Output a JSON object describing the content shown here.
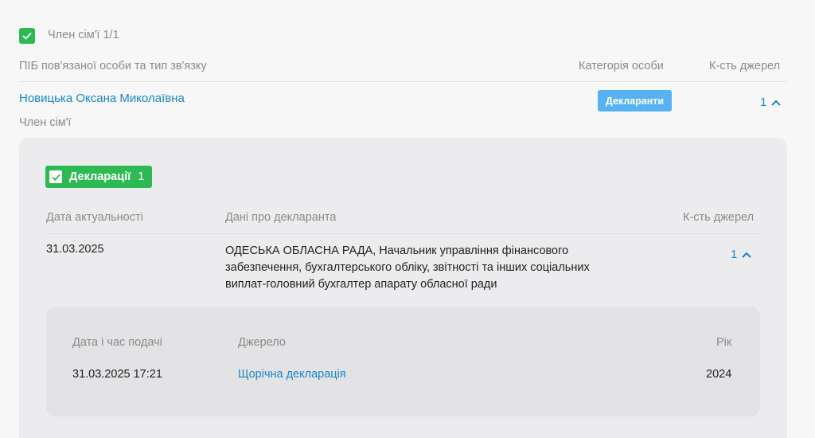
{
  "family": {
    "header_label": "Член сім'ї 1/1",
    "columns": {
      "name": "ПІБ пов'язаної особи та тип зв'язку",
      "category": "Категорія особи",
      "sources": "К-сть джерел"
    },
    "person": {
      "name": "Новицька Оксана Миколаївна",
      "relation": "Член сім'ї",
      "category_badge": "Декларанти",
      "sources_count": "1"
    }
  },
  "declarations": {
    "tag_label": "Декларації",
    "tag_count": "1",
    "columns": {
      "date": "Дата актуальності",
      "info": "Дані про декларанта",
      "sources": "К-сть джерел"
    },
    "row": {
      "date": "31.03.2025",
      "info_line1": "ОДЕСЬКА ОБЛАСНА РАДА, Начальник управління фінансового",
      "info_line2": "забезпечення, бухгалтерського обліку, звітності та інших соціальних",
      "info_line3": "виплат-головний бухгалтер апарату обласної ради",
      "sources_count": "1"
    },
    "sources_table": {
      "columns": {
        "datetime": "Дата і час подачі",
        "source": "Джерело",
        "year": "Рік"
      },
      "row": {
        "datetime": "31.03.2025 17:21",
        "source": "Щорічна декларація",
        "year": "2024"
      }
    }
  },
  "colors": {
    "accent_green": "#2dba54",
    "link_blue": "#1787c9",
    "badge_blue": "#56b2f2"
  },
  "icons": [
    "checkbox-checked-icon",
    "chevron-up-icon"
  ]
}
